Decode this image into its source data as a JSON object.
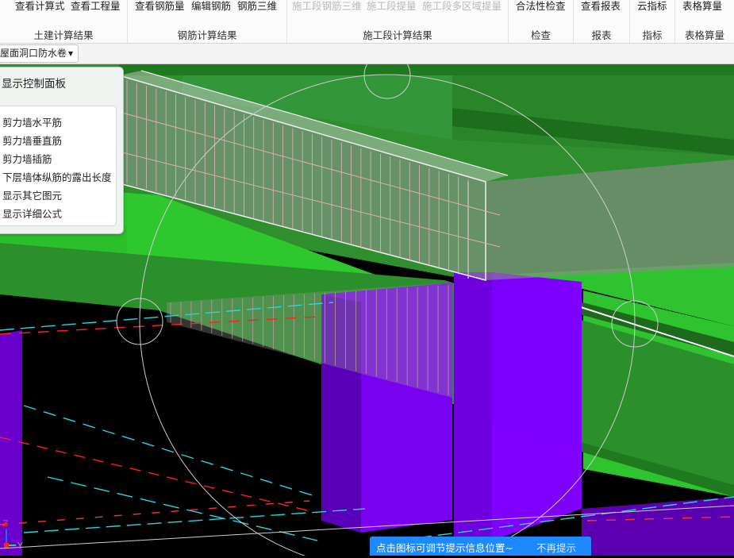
{
  "ribbon": {
    "groups": [
      {
        "title": "土建计算结果",
        "buttons": [
          "查看计算式",
          "查看工程量"
        ]
      },
      {
        "title": "钢筋计算结果",
        "buttons": [
          "查看钢筋量",
          "编辑钢筋",
          "钢筋三维"
        ]
      },
      {
        "title": "施工段计算结果",
        "buttons": [
          "施工段钢筋三维",
          "施工段提量",
          "施工段多区域提量"
        ]
      },
      {
        "title": "检查",
        "buttons": [
          "合法性检查"
        ]
      },
      {
        "title": "报表",
        "buttons": [
          "查看报表"
        ]
      },
      {
        "title": "指标",
        "buttons": [
          "云指标"
        ]
      },
      {
        "title": "表格算量",
        "buttons": [
          "表格算量"
        ]
      }
    ]
  },
  "toolbar": {
    "dropdown_value": "屋面洞口防水卷"
  },
  "control_panel": {
    "title": "显示控制面板",
    "options": [
      "剪力墙水平筋",
      "剪力墙垂直筋",
      "剪力墙插筋",
      "下层墙体纵筋的露出长度",
      "显示其它图元",
      "显示详细公式"
    ]
  },
  "viewport": {
    "axis_labels": {
      "z": "Z",
      "y": "Y"
    }
  },
  "tip": {
    "text": "点击图标可调节提示信息位置~",
    "dismiss": "不再提示"
  },
  "colors": {
    "slab_green": "#2e8b2e",
    "bright_green": "#2ec82e",
    "column_purple": "#7a00f0",
    "tip_blue": "#1e88ff"
  }
}
